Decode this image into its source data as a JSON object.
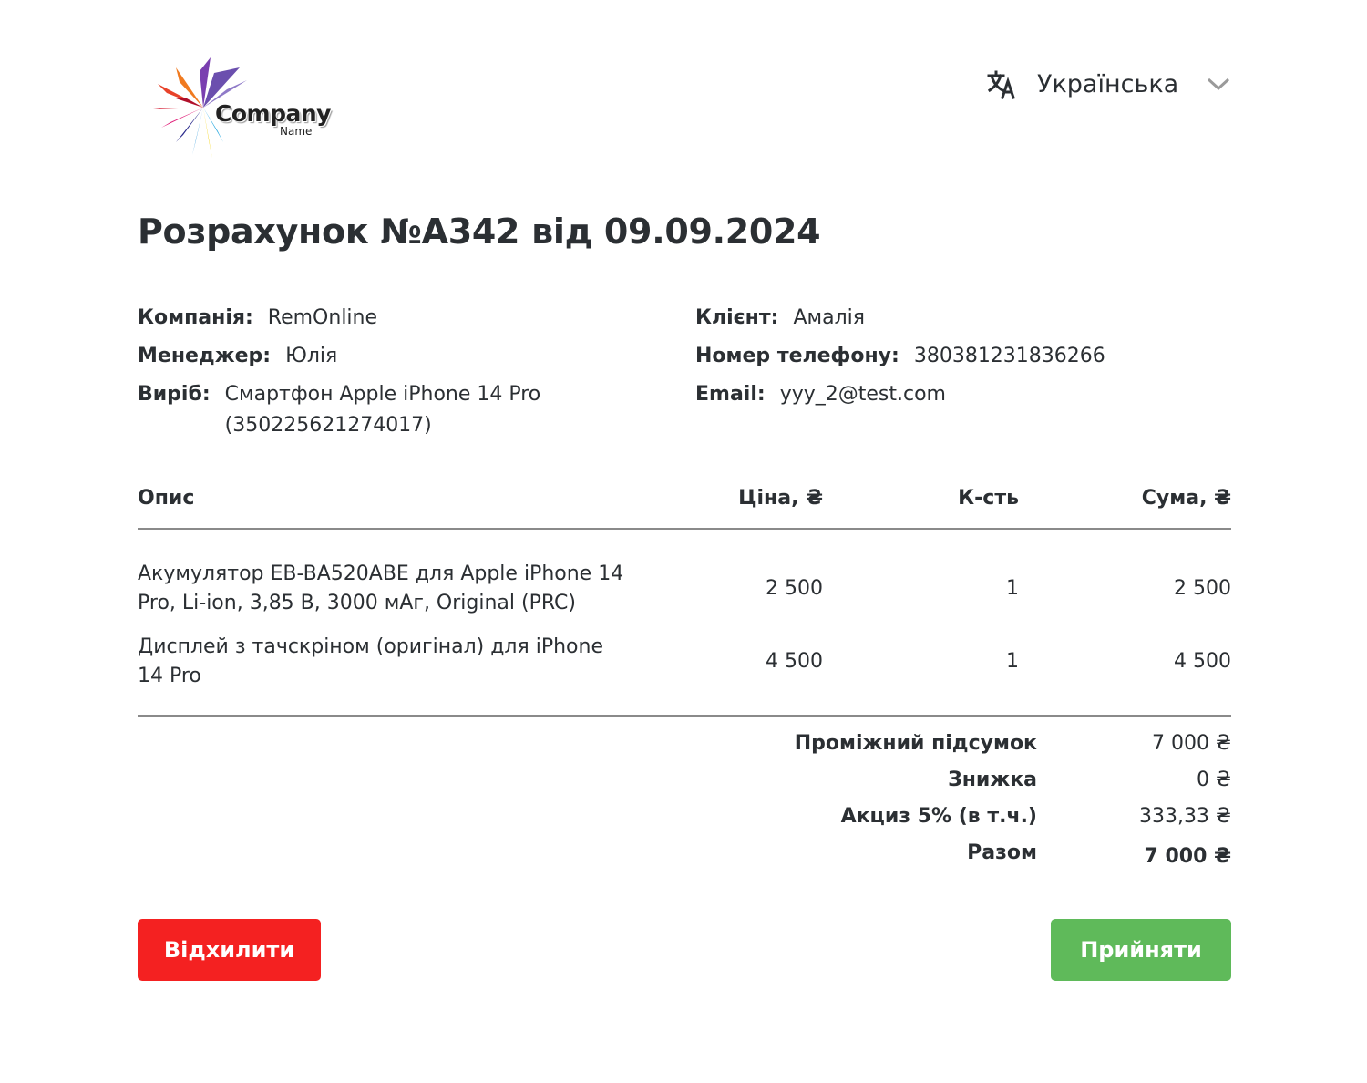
{
  "header": {
    "logo": {
      "word": "Company",
      "sub": "Name"
    },
    "language": {
      "label": "Українська",
      "icon": "translate-icon",
      "chevron": "chevron-down-icon"
    }
  },
  "title": "Розрахунок №A342 від 09.09.2024",
  "info": {
    "company_label": "Компанія:",
    "company_value": "RemOnline",
    "manager_label": "Менеджер:",
    "manager_value": "Юлія",
    "device_label": "Виріб:",
    "device_value_line1": "Смартфон Apple iPhone 14 Pro",
    "device_value_line2": "(350225621274017)",
    "client_label": "Клієнт:",
    "client_value": "Амалія",
    "phone_label": "Номер телефону:",
    "phone_value": "380381231836266",
    "email_label": "Email:",
    "email_value": "yyy_2@test.com"
  },
  "table": {
    "headers": [
      "Опис",
      "Ціна, ₴",
      "К-сть",
      "Сума, ₴"
    ],
    "rows": [
      {
        "desc_line1": "Акумулятор EB-BA520ABE для Apple iPhone 14",
        "desc_line2": "Pro, Li-ion, 3,85 B, 3000 мАг, Original (PRC)",
        "price": "2 500",
        "qty": "1",
        "sum": "2 500"
      },
      {
        "desc_line1": "Дисплей з тачскріном (оригінал) для iPhone",
        "desc_line2": "14 Pro",
        "price": "4 500",
        "qty": "1",
        "sum": "4 500"
      }
    ]
  },
  "totals": {
    "subtotal_label": "Проміжний підсумок",
    "subtotal_value": "7 000 ₴",
    "discount_label": "Знижка",
    "discount_value": "0 ₴",
    "excise_label": "Акциз 5% (в т.ч.)",
    "excise_value": "333,33 ₴",
    "total_label": "Разом",
    "total_value": "7 000 ₴"
  },
  "buttons": {
    "reject": "Відхилити",
    "accept": "Прийняти"
  },
  "colors": {
    "reject": "#f42121",
    "accept": "#5fba5a",
    "text": "#2b2f33"
  }
}
